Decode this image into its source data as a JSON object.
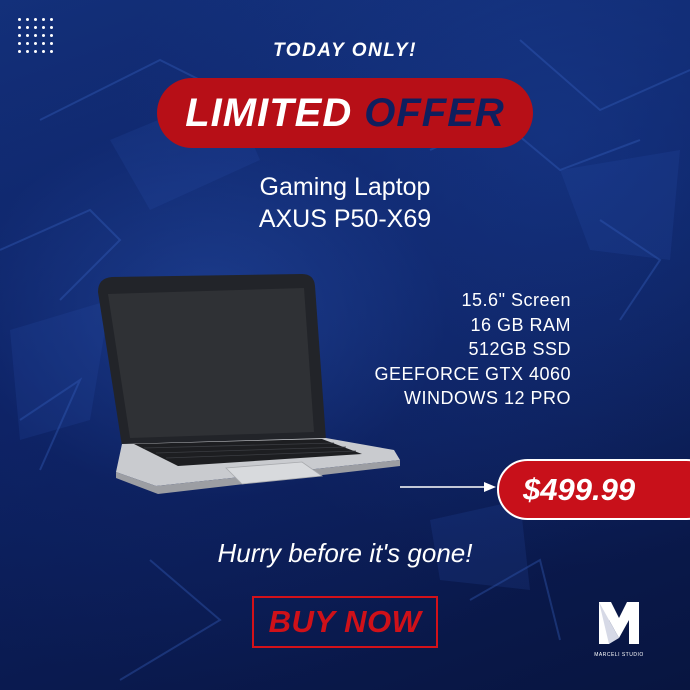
{
  "header": {
    "kicker": "TODAY ONLY!",
    "offer_word1": "LIMITED",
    "offer_word2": "OFFER"
  },
  "product": {
    "line1": "Gaming Laptop",
    "line2": "AXUS P50-X69"
  },
  "specs": [
    "15.6\" Screen",
    "16 GB RAM",
    "512GB SSD",
    "GEEFORCE GTX 4060",
    "WINDOWS 12 PRO"
  ],
  "price": "$499.99",
  "tagline": "Hurry before it's gone!",
  "cta": "BUY NOW",
  "brand": {
    "name": "MARCELI STUDIO",
    "icon": "m-logo-icon"
  },
  "colors": {
    "background": "#0e2158",
    "accent_red": "#b70f17",
    "text_navy": "#0f1f5e",
    "white": "#ffffff"
  }
}
